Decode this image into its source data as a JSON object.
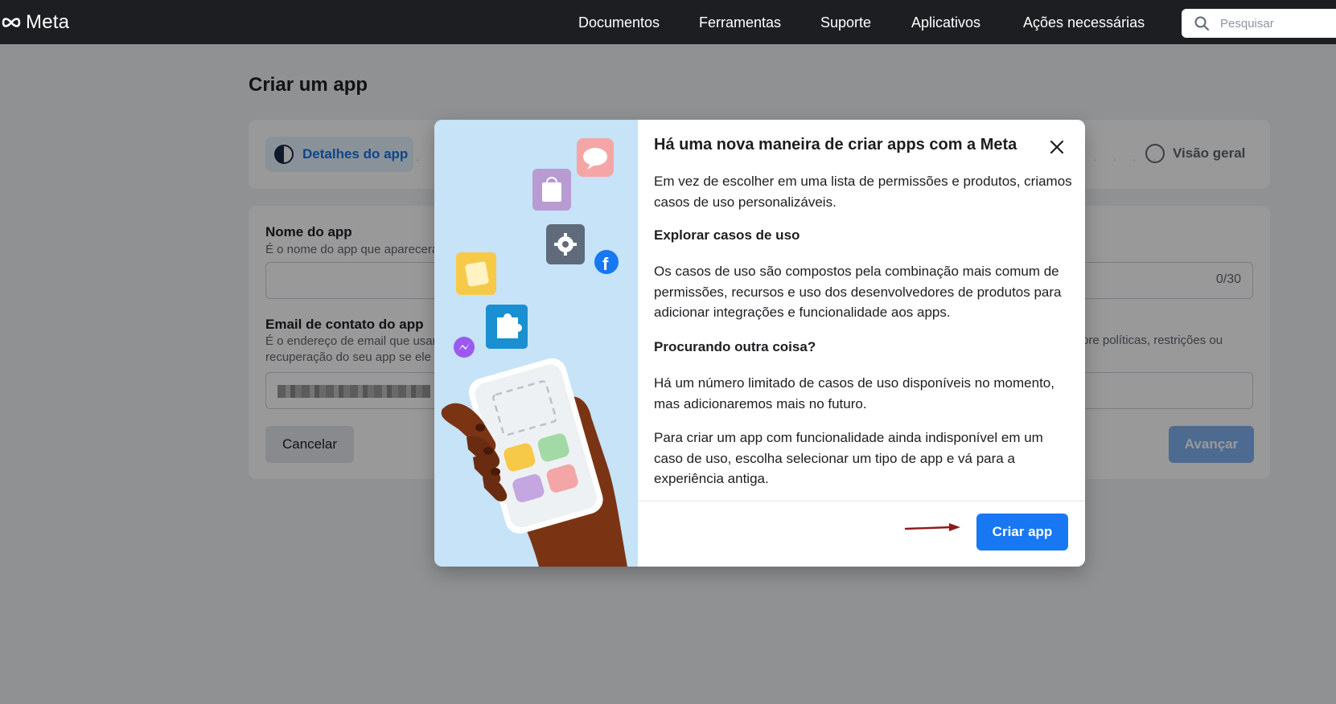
{
  "topbar": {
    "logo_text": "Meta",
    "nav": [
      "Documentos",
      "Ferramentas",
      "Suporte",
      "Aplicativos",
      "Ações necessárias"
    ],
    "search_placeholder": "Pesquisar"
  },
  "page": {
    "title": "Criar um app",
    "steps": {
      "active": "Detalhes do app",
      "last": "Visão geral"
    },
    "form": {
      "app_name_label": "Nome do app",
      "app_name_help": "É o nome do app que aparecerá",
      "app_name_counter": "0/30",
      "email_label": "Email de contato do app",
      "email_help_line1": "É o endereço de email que usar",
      "email_help_line2": "recuperação do seu app se ele",
      "email_help_right": "bre políticas, restrições ou",
      "cancel": "Cancelar",
      "next": "Avançar"
    }
  },
  "modal": {
    "title": "Há uma nova maneira de criar apps com a Meta",
    "paragraphs": {
      "p1": "Em vez de escolher em uma lista de permissões e produtos, criamos casos de uso personalizáveis.",
      "h1": "Explorar casos de uso",
      "p2": "Os casos de uso são compostos pela combinação mais comum de permissões, recursos e uso dos desenvolvedores de produtos para adicionar integrações e funcionalidade aos apps.",
      "h2": "Procurando outra coisa?",
      "p3": "Há um número limitado de casos de uso disponíveis no momento, mas adicionaremos mais no futuro.",
      "p4": "Para criar um app com funcionalidade ainda indisponível em um caso de uso, escolha selecionar um tipo de app e vá para a experiência antiga."
    },
    "create_button": "Criar app"
  },
  "colors": {
    "primary": "#1877f2",
    "topbar": "#1c1e21",
    "annotation_arrow": "#8b1a1a"
  }
}
